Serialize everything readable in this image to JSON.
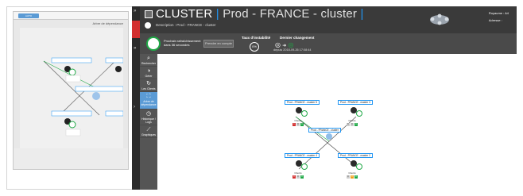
{
  "thumbnail": {
    "tab_label": "AUTO",
    "title": "Arbre de dépendance",
    "nodes": [
      "Prod - FRANCE - master 5",
      "Prod - FRANCE - master 3",
      "Prod - FRANCE - cluster",
      "Prod - FRANCE - master 4",
      "Prod - FRANCE - master 2"
    ]
  },
  "header": {
    "app_name": "CLUSTER",
    "separator": "|",
    "cluster_name": "Prod - FRANCE - cluster",
    "description": "Description : Prod - FRANCE - cluster",
    "kingdom_label": "Royaume : A4",
    "address_label": "Adresse :"
  },
  "subbar": {
    "next_refresh": "Prochain rafraîchissement dans 36 secondes",
    "btn_label": "Prendre en compte",
    "instability_title": "Taux d'instabilité",
    "instability_value": "0%",
    "last_change_title": "Dernier changement",
    "last_change_time": "depuis 2018-09-26 17:08:44"
  },
  "sidenav": [
    {
      "icon": "search-icon",
      "glyph": "⌕",
      "label": "Rechercher"
    },
    {
      "icon": "toggle-icon",
      "glyph": "◑",
      "label": "Gérer"
    },
    {
      "icon": "refresh-icon",
      "glyph": "↻",
      "label": "Les Clients"
    },
    {
      "icon": "tree-icon",
      "glyph": "⛶",
      "label": "Arbre de dépendance"
    },
    {
      "icon": "clock-icon",
      "glyph": "◷",
      "label": "Historique / Logs"
    },
    {
      "icon": "chart-icon",
      "glyph": "⟋",
      "label": "Graphiques"
    }
  ],
  "graph": {
    "nodes": [
      "Prod - FRANCE - master 5",
      "Prod - FRANCE - master 3",
      "Prod - FRANCE - cluster",
      "Prod - FRANCE - master 4",
      "Prod - FRANCE - master 2"
    ],
    "client_label": "Clients",
    "client_badges": [
      "1",
      "0",
      "0"
    ]
  },
  "colors": {
    "accent": "#2196f3",
    "ok": "#1fa846",
    "alert": "#d32f2f"
  }
}
